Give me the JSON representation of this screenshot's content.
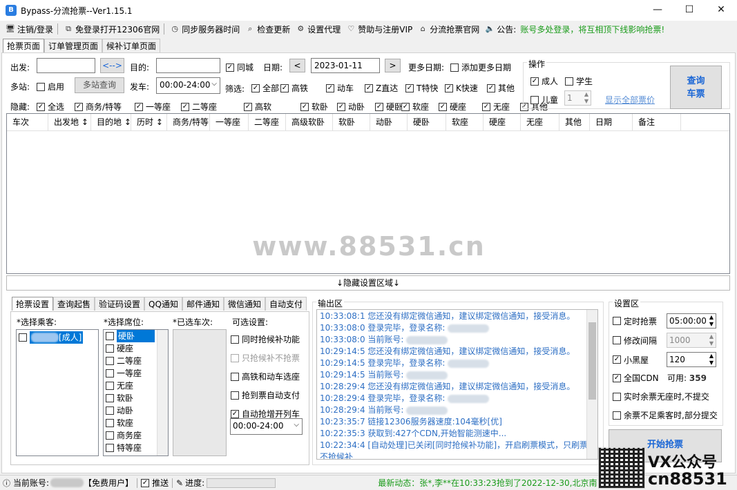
{
  "title": "Bypass-分流抢票--Ver1.15.1",
  "window_buttons": [
    "—",
    "☐",
    "✕"
  ],
  "menu": [
    {
      "icon": "monitor-icon",
      "glyph": "🖥",
      "label": "注销/登录"
    },
    {
      "icon": "window-icon",
      "glyph": "⧉",
      "label": "免登录打开12306官网"
    },
    {
      "icon": "clock-icon",
      "glyph": "◷",
      "label": "同步服务器时间"
    },
    {
      "icon": "search-icon",
      "glyph": "⌕",
      "label": "检查更新"
    },
    {
      "icon": "gear-icon",
      "glyph": "⚙",
      "label": "设置代理"
    },
    {
      "icon": "heart-icon",
      "glyph": "♡",
      "label": "赞助与注册VIP"
    },
    {
      "icon": "home-icon",
      "glyph": "⌂",
      "label": "分流抢票官网"
    },
    {
      "icon": "speaker-icon",
      "glyph": "🔈",
      "label": "公告:"
    }
  ],
  "notice": "账号多处登录，将互相顶下线影响抢票!",
  "tabs": [
    "抢票页面",
    "订单管理页面",
    "候补订单页面"
  ],
  "query": {
    "from_label": "出发:",
    "swap_label": "<-->",
    "to_label": "目的:",
    "same_city": "同城",
    "date_label": "日期:",
    "prev": "<",
    "date": "2023-01-11",
    "next": ">",
    "more_dates_label": "更多日期:",
    "add_more_dates": "添加更多日期",
    "multi_station_label": "多站:",
    "enable": "启用",
    "multi_query": "多站查询",
    "depart_label": "发车:",
    "depart_time": "00:00-24:00",
    "filter_label": "筛选:",
    "filters": [
      "全部",
      "高铁",
      "动车",
      "Z直达",
      "T特快",
      "K快速",
      "其他"
    ],
    "hide_label": "隐藏:",
    "hides": [
      "全选",
      "商务/特等",
      "一等座",
      "二等座",
      "高软",
      "软卧",
      "动卧",
      "硬卧",
      "软座",
      "硬座",
      "无座",
      "其他"
    ]
  },
  "ops": {
    "title": "操作",
    "adult": "成人",
    "student": "学生",
    "child": "儿童",
    "child_count": "1",
    "show_all": "显示全部票价",
    "query_btn_1": "查询",
    "query_btn_2": "车票"
  },
  "grid_columns": [
    "车次",
    "出发地 ↕",
    "目的地 ↕",
    "历时 ↕",
    "商务/特等",
    "一等座",
    "二等座",
    "高级软卧",
    "软卧",
    "动卧",
    "硬卧",
    "软座",
    "硬座",
    "无座",
    "其他",
    "日期",
    "备注"
  ],
  "watermark": "www.88531.cn",
  "hidden_area": "↓隐藏设置区域↓",
  "settings_tabs": [
    "抢票设置",
    "查询起售",
    "验证码设置",
    "QQ通知",
    "邮件通知",
    "微信通知",
    "自动支付"
  ],
  "passenger_label": "*选择乘客:",
  "passenger_suffix": "[成人]",
  "seat_label": "*选择席位:",
  "seats": [
    "硬卧",
    "硬座",
    "二等座",
    "一等座",
    "无座",
    "软卧",
    "动卧",
    "软座",
    "商务座",
    "特等座"
  ],
  "selected_trains_label": "*已选车次:",
  "optional_label": "可选设置:",
  "optional": [
    {
      "label": "同时抢候补功能",
      "checked": false,
      "disabled": false
    },
    {
      "label": "只抢候补不抢票",
      "checked": false,
      "disabled": true
    },
    {
      "label": "高铁和动车选座",
      "checked": false,
      "disabled": false
    },
    {
      "label": "抢到票自动支付",
      "checked": false,
      "disabled": false
    },
    {
      "label": "自动抢增开列车",
      "checked": true,
      "disabled": false
    }
  ],
  "extra_time": "00:00-24:00",
  "output_label": "输出区",
  "output_lines": [
    {
      "t": "10:33:08:1",
      "m": "您还没有绑定微信通知，建议绑定微信通知，接受消息。"
    },
    {
      "t": "10:33:08:0",
      "m": "登录完毕，登录名称:"
    },
    {
      "t": "10:33:08:0",
      "m": "当前账号:"
    },
    {
      "t": "10:29:14:5",
      "m": "您还没有绑定微信通知，建议绑定微信通知，接受消息。"
    },
    {
      "t": "10:29:14:5",
      "m": "登录完毕，登录名称:"
    },
    {
      "t": "10:29:14:5",
      "m": "当前账号:"
    },
    {
      "t": "10:28:29:4",
      "m": "您还没有绑定微信通知，建议绑定微信通知，接受消息。"
    },
    {
      "t": "10:28:29:4",
      "m": "登录完毕，登录名称:"
    },
    {
      "t": "10:28:29:4",
      "m": "当前账号:"
    },
    {
      "t": "10:23:35:7",
      "m": "链接12306服务器速度:104毫秒[优]"
    },
    {
      "t": "10:22:35:3",
      "m": "获取到:427个CDN,开始智能测速中..."
    },
    {
      "t": "10:22:34:4",
      "m": "[自动处理]已关闭[同时抢候补功能]，开启刷票模式，只刷票"
    },
    {
      "t": "",
      "m": "不抢候补"
    }
  ],
  "settings_label": "设置区",
  "settings": [
    {
      "label": "定时抢票",
      "checked": false,
      "value": "05:00:00",
      "disabled": false
    },
    {
      "label": "修改间隔",
      "checked": false,
      "value": "1000",
      "disabled": true
    },
    {
      "label": "小黑屋",
      "checked": true,
      "value": "120",
      "disabled": false
    }
  ],
  "cdn": {
    "label": "全国CDN",
    "avail_label": "可用:",
    "avail": "359"
  },
  "settings_more": [
    "实时余票无座时,不提交",
    "余票不足乘客时,部分提交"
  ],
  "start_btn": "开始抢票",
  "status": {
    "account_label": "当前账号:",
    "user_type": "【免费用户】",
    "push": "推送",
    "progress": "进度:",
    "news": "最新动态：张*,李**在10:33:23抢到了2022-12-30,北京南-"
  },
  "overlay": {
    "vx": "VX公众号",
    "cn": "cn88531"
  },
  "colors": {
    "blue": "#2e6fc4",
    "green": "#1a9b1a",
    "start_btn_text": "#1a66d6"
  }
}
